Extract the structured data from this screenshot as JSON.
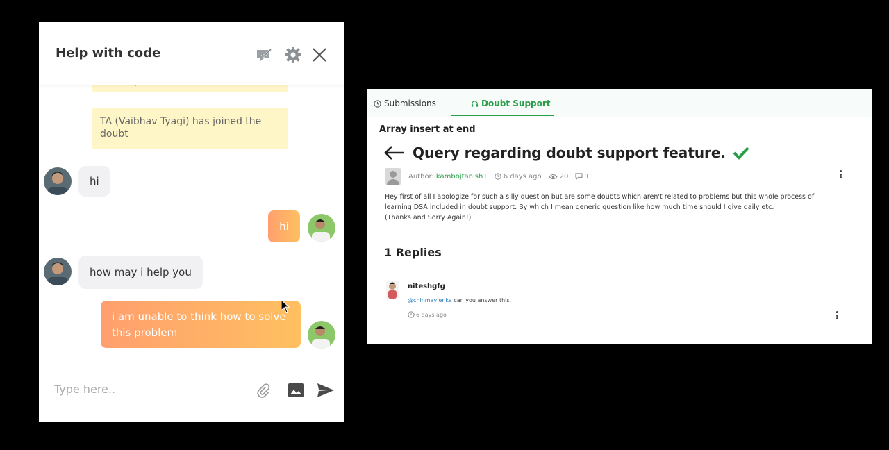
{
  "chat": {
    "title": "Help with code",
    "partial_message": "will respond soon",
    "system_message": "TA (Vaibhav Tyagi) has joined the doubt",
    "messages": [
      {
        "from": "ta",
        "text": "hi"
      },
      {
        "from": "me",
        "text": "hi"
      },
      {
        "from": "ta",
        "text": "how may i help you"
      },
      {
        "from": "me",
        "text": "i am unable to think how to solve this problem"
      }
    ],
    "input_placeholder": "Type here.."
  },
  "doubt": {
    "tabs": [
      {
        "label": "Submissions",
        "icon": "clock-icon"
      },
      {
        "label": "Doubt Support",
        "icon": "headset-icon"
      }
    ],
    "problem_name": "Array insert at end",
    "question_title": "Query regarding doubt support feature.",
    "author_label": "Author:",
    "author": "kambojtanish1",
    "time_ago": "6 days ago",
    "views": "20",
    "comments": "1",
    "body_lines": [
      "Hey first of all I apologize for such a silly question but are some doubts which aren't related to problems but this whole process of",
      "learning DSA included in doubt support. By which I mean generic question like how much time should I give daily etc.",
      "(Thanks and Sorry Again!)"
    ],
    "replies_heading": "1 Replies",
    "reply": {
      "name": "niteshgfg",
      "mention": "@chinmaylenka",
      "text": "can you answer this.",
      "time": "6 days ago"
    },
    "accent": "#2a9d48"
  }
}
